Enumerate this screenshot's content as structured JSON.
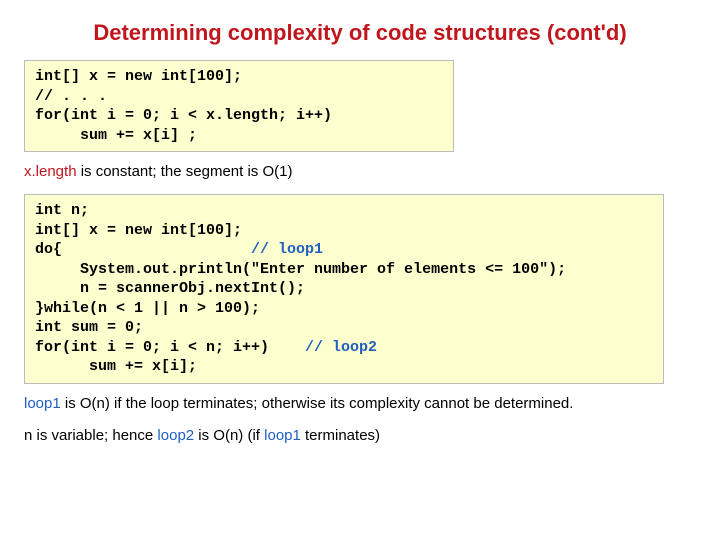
{
  "title": "Determining complexity of code structures (cont'd)",
  "code1": {
    "l1": "int[] x = new int[100];",
    "l2": "// . . .",
    "l3": "for(int i = 0; i < x.length; i++)",
    "l4": "     sum += x[i] ;"
  },
  "note1": {
    "t1": "x.length",
    "t2": " is constant; the segment is O(1)"
  },
  "code2": {
    "l1": "int n;",
    "l2": "int[] x = new int[100];",
    "l3a": "do{                     ",
    "l3b": "// loop1",
    "l4": "     System.out.println(\"Enter number of elements <= 100\");",
    "l5": "     n = scannerObj.nextInt();",
    "l6": "}while(n < 1 || n > 100);",
    "l7": "int sum = 0;",
    "l8a": "for(int i = 0; i < n; i++)    ",
    "l8b": "// loop2",
    "l9": "      sum += x[i];"
  },
  "note2": {
    "t1": "loop1",
    "t2": " is O(n) if the loop terminates; otherwise its complexity cannot be determined."
  },
  "note3": {
    "t1": "n is variable; hence ",
    "t2": "loop2",
    "t3": " is O(n)",
    "t4": "    (if ",
    "t5": "loop1",
    "t6": " terminates)"
  }
}
